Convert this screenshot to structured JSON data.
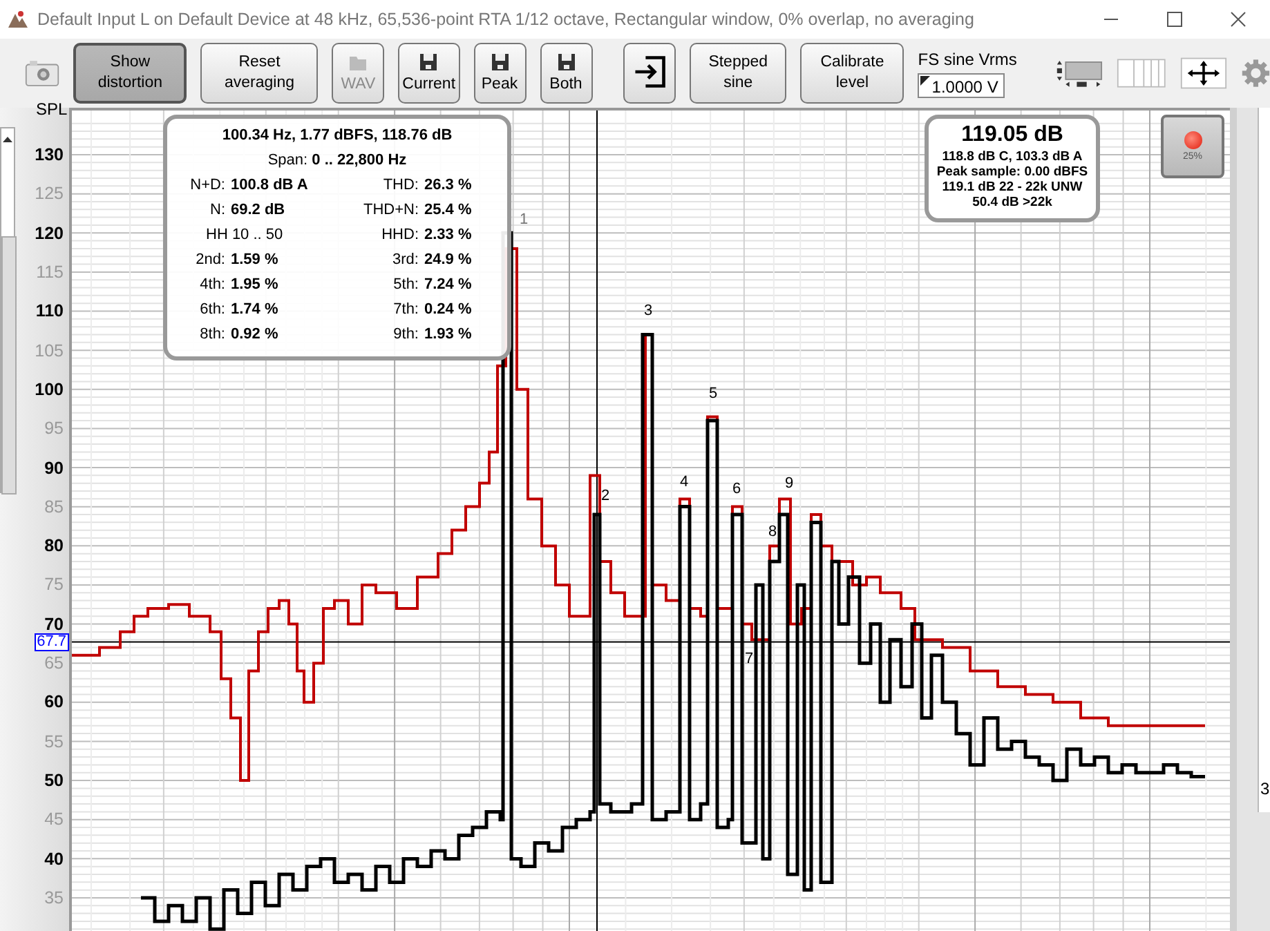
{
  "window": {
    "title": "Default Input L on Default Device at 48 kHz, 65,536-point RTA 1/12 octave, Rectangular window, 0% overlap, no averaging"
  },
  "toolbar": {
    "buttons": [
      {
        "kind": "text",
        "label": "Show distortion",
        "on": true,
        "disabled": false
      },
      {
        "kind": "text",
        "label": "Reset averaging",
        "on": false,
        "disabled": false
      },
      {
        "kind": "folder",
        "label": "WAV",
        "on": false,
        "disabled": true
      },
      {
        "kind": "save",
        "label": "Current",
        "on": false,
        "disabled": false
      },
      {
        "kind": "save",
        "label": "Peak",
        "on": false,
        "disabled": false
      },
      {
        "kind": "save",
        "label": "Both",
        "on": false,
        "disabled": false
      },
      {
        "kind": "icon",
        "on": false,
        "disabled": false
      },
      {
        "kind": "text",
        "label": "Stepped sine",
        "on": false,
        "disabled": false
      },
      {
        "kind": "text",
        "label": "Calibrate level",
        "on": false,
        "disabled": false
      }
    ],
    "fs_label": "FS sine Vrms",
    "fs_value": "1.0000 V"
  },
  "axis": {
    "title": "SPL",
    "labels": [
      {
        "text": "130",
        "major": true
      },
      {
        "text": "125",
        "major": false
      },
      {
        "text": "120",
        "major": true
      },
      {
        "text": "115",
        "major": false
      },
      {
        "text": "110",
        "major": true
      },
      {
        "text": "105",
        "major": false
      },
      {
        "text": "100",
        "major": true
      },
      {
        "text": "95",
        "major": false
      },
      {
        "text": "90",
        "major": true
      },
      {
        "text": "85",
        "major": false
      },
      {
        "text": "80",
        "major": true
      },
      {
        "text": "75",
        "major": false
      },
      {
        "text": "70",
        "major": true
      },
      {
        "text": "65",
        "major": false
      },
      {
        "text": "60",
        "major": true
      },
      {
        "text": "55",
        "major": false
      },
      {
        "text": "50",
        "major": true
      },
      {
        "text": "45",
        "major": false
      },
      {
        "text": "40",
        "major": true
      },
      {
        "text": "35",
        "major": false
      }
    ],
    "cursor_value": "67.7"
  },
  "plot": {
    "harmonics": [
      "1",
      "2",
      "3",
      "4",
      "5",
      "6",
      "7",
      "8",
      "9"
    ],
    "info": {
      "header": "100.34 Hz, 1.77 dBFS, 118.76 dB",
      "span": "Span: **0 .. 22,800 Hz**",
      "rows": [
        [
          {
            "label": "N+D:",
            "value": "100.8 dB A"
          },
          {
            "label": "THD:",
            "value": "26.3 %"
          }
        ],
        [
          {
            "label": "N:",
            "value": "69.2 dB"
          },
          {
            "label": "THD+N:",
            "value": "25.4 %"
          }
        ],
        [
          {
            "label": "HH 10 .. 50"
          },
          {
            "label": "HHD:",
            "value": "2.33 %"
          }
        ],
        [
          {
            "label": "2nd:",
            "value": "1.59 %"
          },
          {
            "label": "3rd:",
            "value": "24.9 %"
          }
        ],
        [
          {
            "label": "4th:",
            "value": "1.95 %"
          },
          {
            "label": "5th:",
            "value": "7.24 %"
          }
        ],
        [
          {
            "label": "6th:",
            "value": "1.74 %"
          },
          {
            "label": "7th:",
            "value": "0.24 %"
          }
        ],
        [
          {
            "label": "8th:",
            "value": "0.92 %"
          },
          {
            "label": "9th:",
            "value": "1.93 %"
          }
        ]
      ]
    },
    "level": {
      "main": "119.05 dB",
      "lines": [
        "118.8 dB C, 103.3 dB A",
        "Peak sample: 0.00 dBFS",
        "119.1 dB 22 - 22k UNW",
        "50.4 dB >22k"
      ]
    },
    "clip": {
      "on": true,
      "label": "25%"
    }
  },
  "behind_window": {
    "label": "3"
  }
}
